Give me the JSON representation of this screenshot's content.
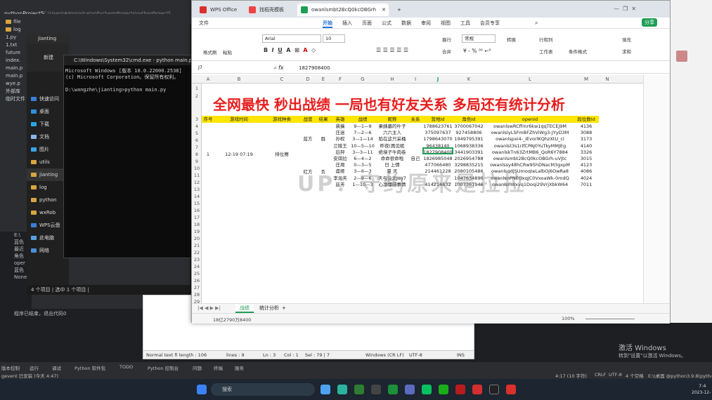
{
  "ide": {
    "title": "pythonProject5",
    "path": "C:\\Users\\Administrator\\PycharmProjects\\pythonProject5",
    "right_title": "pythonPr",
    "tree": [
      "file",
      "log",
      "1.py",
      "1.txt",
      "future",
      "index.",
      "main.p",
      "main.p",
      "wye.p",
      "外部库",
      "临时文件"
    ],
    "status_left": "程序已结束，退出代码0",
    "none": "None",
    "run_lines": [
      "E:\\",
      "蓝色",
      "最近",
      "角色",
      "oper",
      "蓝色",
      "None"
    ],
    "bottom_tabs": [
      "版本控制",
      "运行",
      "调试",
      "Python 软件包",
      "TODO",
      "Python 控制台",
      "问题",
      "终端",
      "服务"
    ],
    "status_right": [
      "4:17 (10 字符)",
      "CRLF",
      "UTF-8",
      "4 个空格",
      "E:\\\\桌面 @python3.9.8(pythonP"
    ],
    "status_bottom": "gevent 已安装 (今天 4:47)"
  },
  "explorer": {
    "items": [
      "快速访问",
      "桌面",
      "下载",
      "文档",
      "图片",
      "utils",
      "jianting",
      "log",
      "python",
      "wxRob",
      "WPS云盘",
      "此电脑",
      "网络"
    ],
    "status": "4 个项目  |  选中 1 个项目  |",
    "newbtn": "新建",
    "folder": "jianting"
  },
  "cmd": {
    "title": "C:\\Windows\\System32\\cmd.exe - python main.py",
    "lines": [
      "Microsoft Windows [版本 10.0.22000.2538]",
      "(c) Microsoft Corporation。保留所有权利。",
      "",
      "D:\\wangzhe\\jianting>python main.py"
    ]
  },
  "notepad": {
    "status": [
      "Normal text fi length : 106",
      "lines : 9",
      "Ln : 3",
      "Col : 1",
      "Sel : 79 | 7",
      "Windows (CR LF)",
      "UTF-8",
      "INS"
    ]
  },
  "wps": {
    "tabs": [
      "WPS Office",
      "找稻壳模板",
      "owanlsmbt2BcQ0kcOBGrh"
    ],
    "menu": [
      "文件",
      "开始",
      "插入",
      "页面",
      "公式",
      "数据",
      "审阅",
      "视图",
      "工具",
      "会员专享"
    ],
    "share": "分享",
    "ribbon": {
      "font": "Arial",
      "size": "10",
      "numfmt": "常规",
      "b1": "格式刷",
      "b2": "粘贴",
      "b3": "转换",
      "b4": "行和列",
      "b5": "工作表",
      "b6": "条件格式",
      "b7": "填充",
      "b8": "求和",
      "wrap": "换行",
      "merge": "合并"
    },
    "cellref": "J7",
    "formula": "1827908400",
    "cols": [
      "A",
      "B",
      "C",
      "D",
      "E",
      "F",
      "G",
      "H",
      "I",
      "J",
      "K",
      "L",
      "M",
      "N"
    ],
    "title": "全网最快 秒出战绩 一局也有好友关系 多局还有统计分析",
    "headers": [
      "序号",
      "游戏时间",
      "游戏种类",
      "战营",
      "结果",
      "英雄",
      "战绩",
      "昵称",
      "关系",
      "营地Id",
      "角色Id",
      "openid",
      "段位数Id"
    ],
    "merged": {
      "seq": "1",
      "time": "12-19 07:19",
      "type": "排位赛",
      "camp1": "蓝方",
      "res1": "胜",
      "camp2": "红方",
      "res2": "负",
      "rel": "自己"
    },
    "rows": [
      [
        "裴擒",
        "9—1—9",
        "果姨墓的叶子",
        "1788623761",
        "3700067042",
        "owanlswRCffmr6kw1qqTECEj9M",
        "4136"
      ],
      [
        "庄迷",
        "7—2—6",
        "六六主人",
        "375097637",
        "927458806",
        "owanlslyLSFmBFZhViWg3-JYyD3M",
        "3088"
      ],
      [
        "孙权",
        "3—1—14",
        "陷在这只采桶",
        "1798643070",
        "1949795391",
        "owanlspxi4-_iEvorlKQhzXtU_cI",
        "3173"
      ],
      [
        "兰陵王",
        "10—5—10",
        "昨夜(再见昵",
        "96438140",
        "1068938336",
        "owanlst3s1rIfCPAJ0YuTkyMMJEg",
        "4140"
      ],
      [
        "后羿",
        "3—3—11",
        "绝境子牛肉卷",
        "1827908400",
        "3441903391",
        "owanlskTn63ZrtMB6_QoR6Y7884",
        "3326"
      ],
      [
        "安琪拉",
        "6—4—2",
        "命命很命啦",
        "1826985048",
        "2026954788",
        "owanlsmbt2BcQ0kcOBGrh-uVJtc",
        "3015"
      ],
      [
        "庄周",
        "0—3—5",
        "日  上情",
        "477066480",
        "3298835215",
        "owanlssy48hCRw95hDNacM3gxpM",
        "4123"
      ],
      [
        "虞姬",
        "3—6—3",
        "夏  天",
        "214461228",
        "2080105486",
        "owanlsqdjSUmoqteLalbOj6OwRa8",
        "4086"
      ],
      [
        "李元芳",
        "2—9—6",
        "天与云北Jay7",
        "",
        "1047634890",
        "owanlsnPNEGxqJC0VxoaWk-0mdQ",
        "4024"
      ],
      [
        "廷芳",
        "1—10—3",
        "心净懂脑事情",
        "414214632",
        "1007361946",
        "owanlsnWxvq1Doqi29VrjXbkW64",
        "7011"
      ]
    ],
    "watermark": "UP：守约原来是拉拉",
    "sheets": [
      "战绩",
      "统计分析"
    ],
    "status_val": "18亿2790万8400",
    "zoom": "100%"
  },
  "taskbar": {
    "search": "搜索",
    "time": "7:4",
    "date": "2023-12-"
  },
  "activate": [
    "激活 Windows",
    "转到\"设置\"以激活 Windows。"
  ]
}
